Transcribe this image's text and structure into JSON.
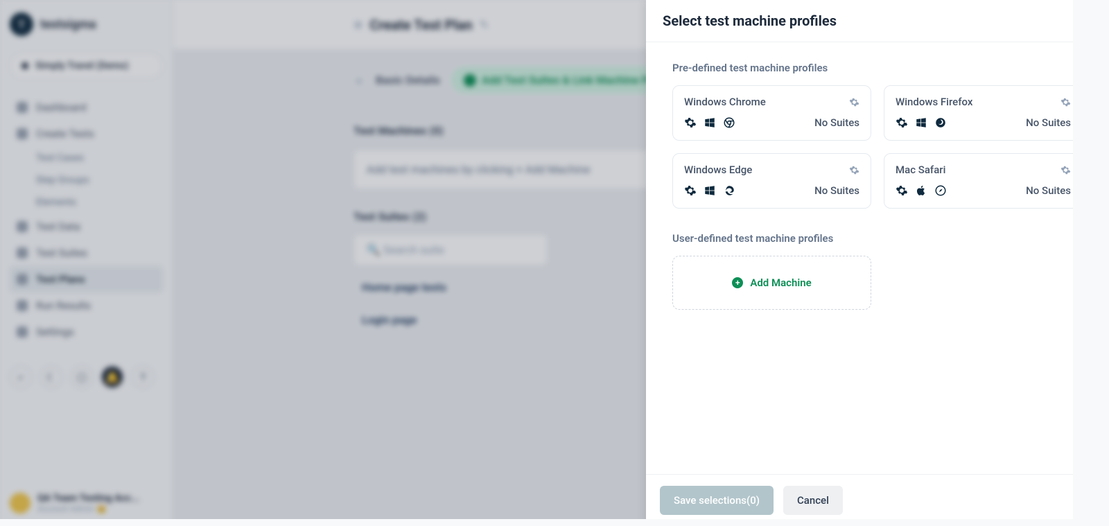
{
  "brand": {
    "name": "testsigma",
    "initial": "T"
  },
  "app_selector": {
    "label": "Simply Travel (Demo)"
  },
  "nav": {
    "dashboard": "Dashboard",
    "create_tests": "Create Tests",
    "test_cases": "Test Cases",
    "step_groups": "Step Groups",
    "elements": "Elements",
    "test_data": "Test Data",
    "test_suites": "Test Suites",
    "test_plans": "Test Plans",
    "run_results": "Run Results",
    "settings": "Settings"
  },
  "bottom_user": {
    "team": "QA Team Testing Acc...",
    "role": "Account Admin 👑"
  },
  "page": {
    "title": "Create Test Plan",
    "basic_label": "Basic Details",
    "add_suites_chip": "Add Test Suites & Link Machine Profiles",
    "test_machines_heading": "Test Machines (0)",
    "machines_placeholder": "Add test machines by clicking  +  Add Machine",
    "test_suites_heading": "Test Suites (2)",
    "search_placeholder": "Search suite",
    "suite_1": "Home page tests",
    "suite_2": "Login page"
  },
  "drawer": {
    "title": "Select test machine profiles",
    "predefined_label": "Pre-defined test machine profiles",
    "userdefined_label": "User-defined test machine profiles",
    "profiles": [
      {
        "name": "Windows Chrome",
        "suites": "No Suites",
        "icons": [
          "gear",
          "windows",
          "chrome"
        ]
      },
      {
        "name": "Windows Firefox",
        "suites": "No Suites",
        "icons": [
          "gear",
          "windows",
          "firefox"
        ]
      },
      {
        "name": "Windows Edge",
        "suites": "No Suites",
        "icons": [
          "gear",
          "windows",
          "edge"
        ]
      },
      {
        "name": "Mac Safari",
        "suites": "No Suites",
        "icons": [
          "gear",
          "apple",
          "safari"
        ]
      }
    ],
    "add_machine_label": "Add Machine",
    "save_label": "Save selections(0)",
    "cancel_label": "Cancel"
  }
}
